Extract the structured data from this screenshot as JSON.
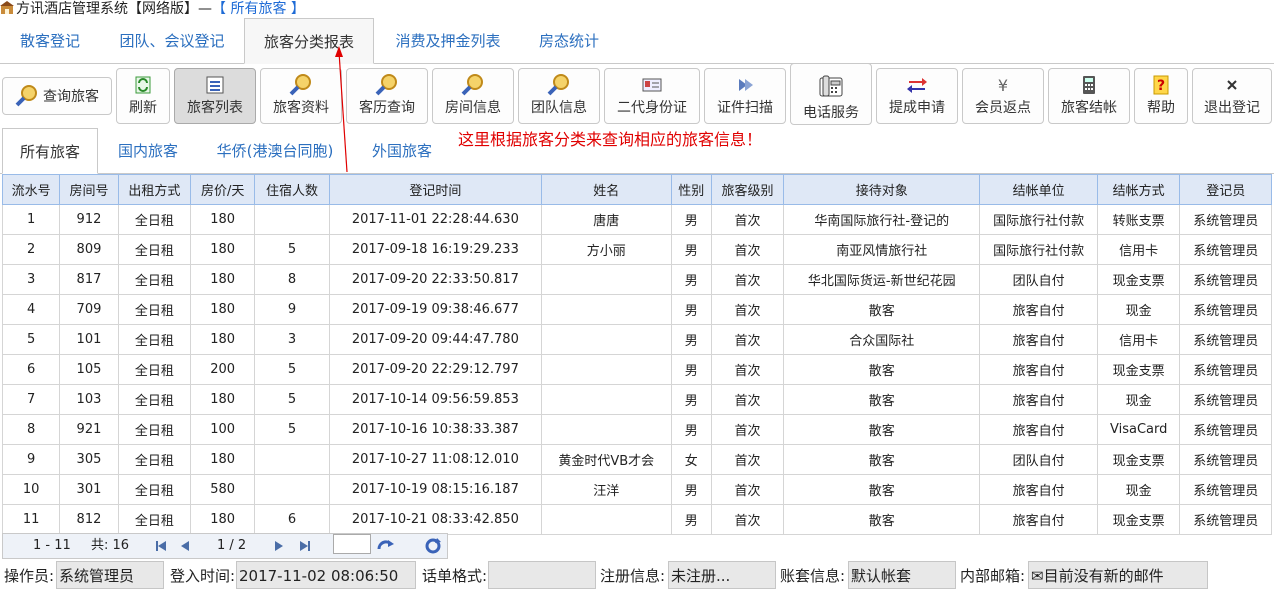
{
  "window": {
    "title": "方讯酒店管理系统【网络版】—",
    "subtitle": "【 所有旅客 】"
  },
  "top_tabs": [
    {
      "label": "散客登记"
    },
    {
      "label": "团队、会议登记"
    },
    {
      "label": "旅客分类报表"
    },
    {
      "label": "消费及押金列表"
    },
    {
      "label": "房态统计"
    }
  ],
  "toolbar": {
    "query_guest": "查询旅客",
    "refresh": "刷新",
    "guest_list": "旅客列表",
    "guest_info": "旅客资料",
    "history_query": "客历查询",
    "room_info": "房间信息",
    "group_info": "团队信息",
    "id_card": "二代身份证",
    "doc_scan": "证件扫描",
    "phone_service": "电话服务",
    "submit_request": "提成申请",
    "member_rebate": "会员返点",
    "guest_checkout": "旅客结帐",
    "help": "帮助",
    "logout": "退出登记"
  },
  "sub_tabs": [
    {
      "label": "所有旅客"
    },
    {
      "label": "国内旅客"
    },
    {
      "label": "华侨(港澳台同胞)"
    },
    {
      "label": "外国旅客"
    }
  ],
  "annotation": "这里根据旅客分类来查询相应的旅客信息！",
  "table": {
    "columns": [
      "流水号",
      "房间号",
      "出租方式",
      "房价/天",
      "住宿人数",
      "登记时间",
      "姓名",
      "性别",
      "旅客级别",
      "接待对象",
      "结帐单位",
      "结帐方式",
      "登记员"
    ],
    "rows": [
      [
        "1",
        "912",
        "全日租",
        "180",
        "",
        "2017-11-01 22:28:44.630",
        "唐唐",
        "男",
        "首次",
        "华南国际旅行社-登记的",
        "国际旅行社付款",
        "转账支票",
        "系统管理员"
      ],
      [
        "2",
        "809",
        "全日租",
        "180",
        "5",
        "2017-09-18 16:19:29.233",
        "方小丽",
        "男",
        "首次",
        "南亚风情旅行社",
        "国际旅行社付款",
        "信用卡",
        "系统管理员"
      ],
      [
        "3",
        "817",
        "全日租",
        "180",
        "8",
        "2017-09-20 22:33:50.817",
        "",
        "男",
        "首次",
        "华北国际货运-新世纪花园",
        "团队自付",
        "现金支票",
        "系统管理员"
      ],
      [
        "4",
        "709",
        "全日租",
        "180",
        "9",
        "2017-09-19 09:38:46.677",
        "",
        "男",
        "首次",
        "散客",
        "旅客自付",
        "现金",
        "系统管理员"
      ],
      [
        "5",
        "101",
        "全日租",
        "180",
        "3",
        "2017-09-20 09:44:47.780",
        "",
        "男",
        "首次",
        "合众国际社",
        "旅客自付",
        "信用卡",
        "系统管理员"
      ],
      [
        "6",
        "105",
        "全日租",
        "200",
        "5",
        "2017-09-20 22:29:12.797",
        "",
        "男",
        "首次",
        "散客",
        "旅客自付",
        "现金支票",
        "系统管理员"
      ],
      [
        "7",
        "103",
        "全日租",
        "180",
        "5",
        "2017-10-14 09:56:59.853",
        "",
        "男",
        "首次",
        "散客",
        "旅客自付",
        "现金",
        "系统管理员"
      ],
      [
        "8",
        "921",
        "全日租",
        "100",
        "5",
        "2017-10-16 10:38:33.387",
        "",
        "男",
        "首次",
        "散客",
        "旅客自付",
        "VisaCard",
        "系统管理员"
      ],
      [
        "9",
        "305",
        "全日租",
        "180",
        "",
        "2017-10-27 11:08:12.010",
        "黄金时代VB才会",
        "女",
        "首次",
        "散客",
        "团队自付",
        "现金支票",
        "系统管理员"
      ],
      [
        "10",
        "301",
        "全日租",
        "580",
        "",
        "2017-10-19 08:15:16.187",
        "汪洋",
        "男",
        "首次",
        "散客",
        "旅客自付",
        "现金",
        "系统管理员"
      ],
      [
        "11",
        "812",
        "全日租",
        "180",
        "6",
        "2017-10-21 08:33:42.850",
        "",
        "男",
        "首次",
        "散客",
        "旅客自付",
        "现金支票",
        "系统管理员"
      ]
    ]
  },
  "pager": {
    "range": "1 - 11",
    "total": "共: 16",
    "page": "1 / 2"
  },
  "status": {
    "operator_label": "操作员:",
    "operator": "系统管理员",
    "login_label": "登入时间:",
    "login_time": "2017-11-02 08:06:50",
    "format_label": "话单格式:",
    "format": "",
    "reg_label": "注册信息:",
    "reg": "未注册...",
    "account_label": "账套信息:",
    "account": "默认帐套",
    "mail_label": "内部邮箱:",
    "mail": "目前没有新的邮件"
  }
}
